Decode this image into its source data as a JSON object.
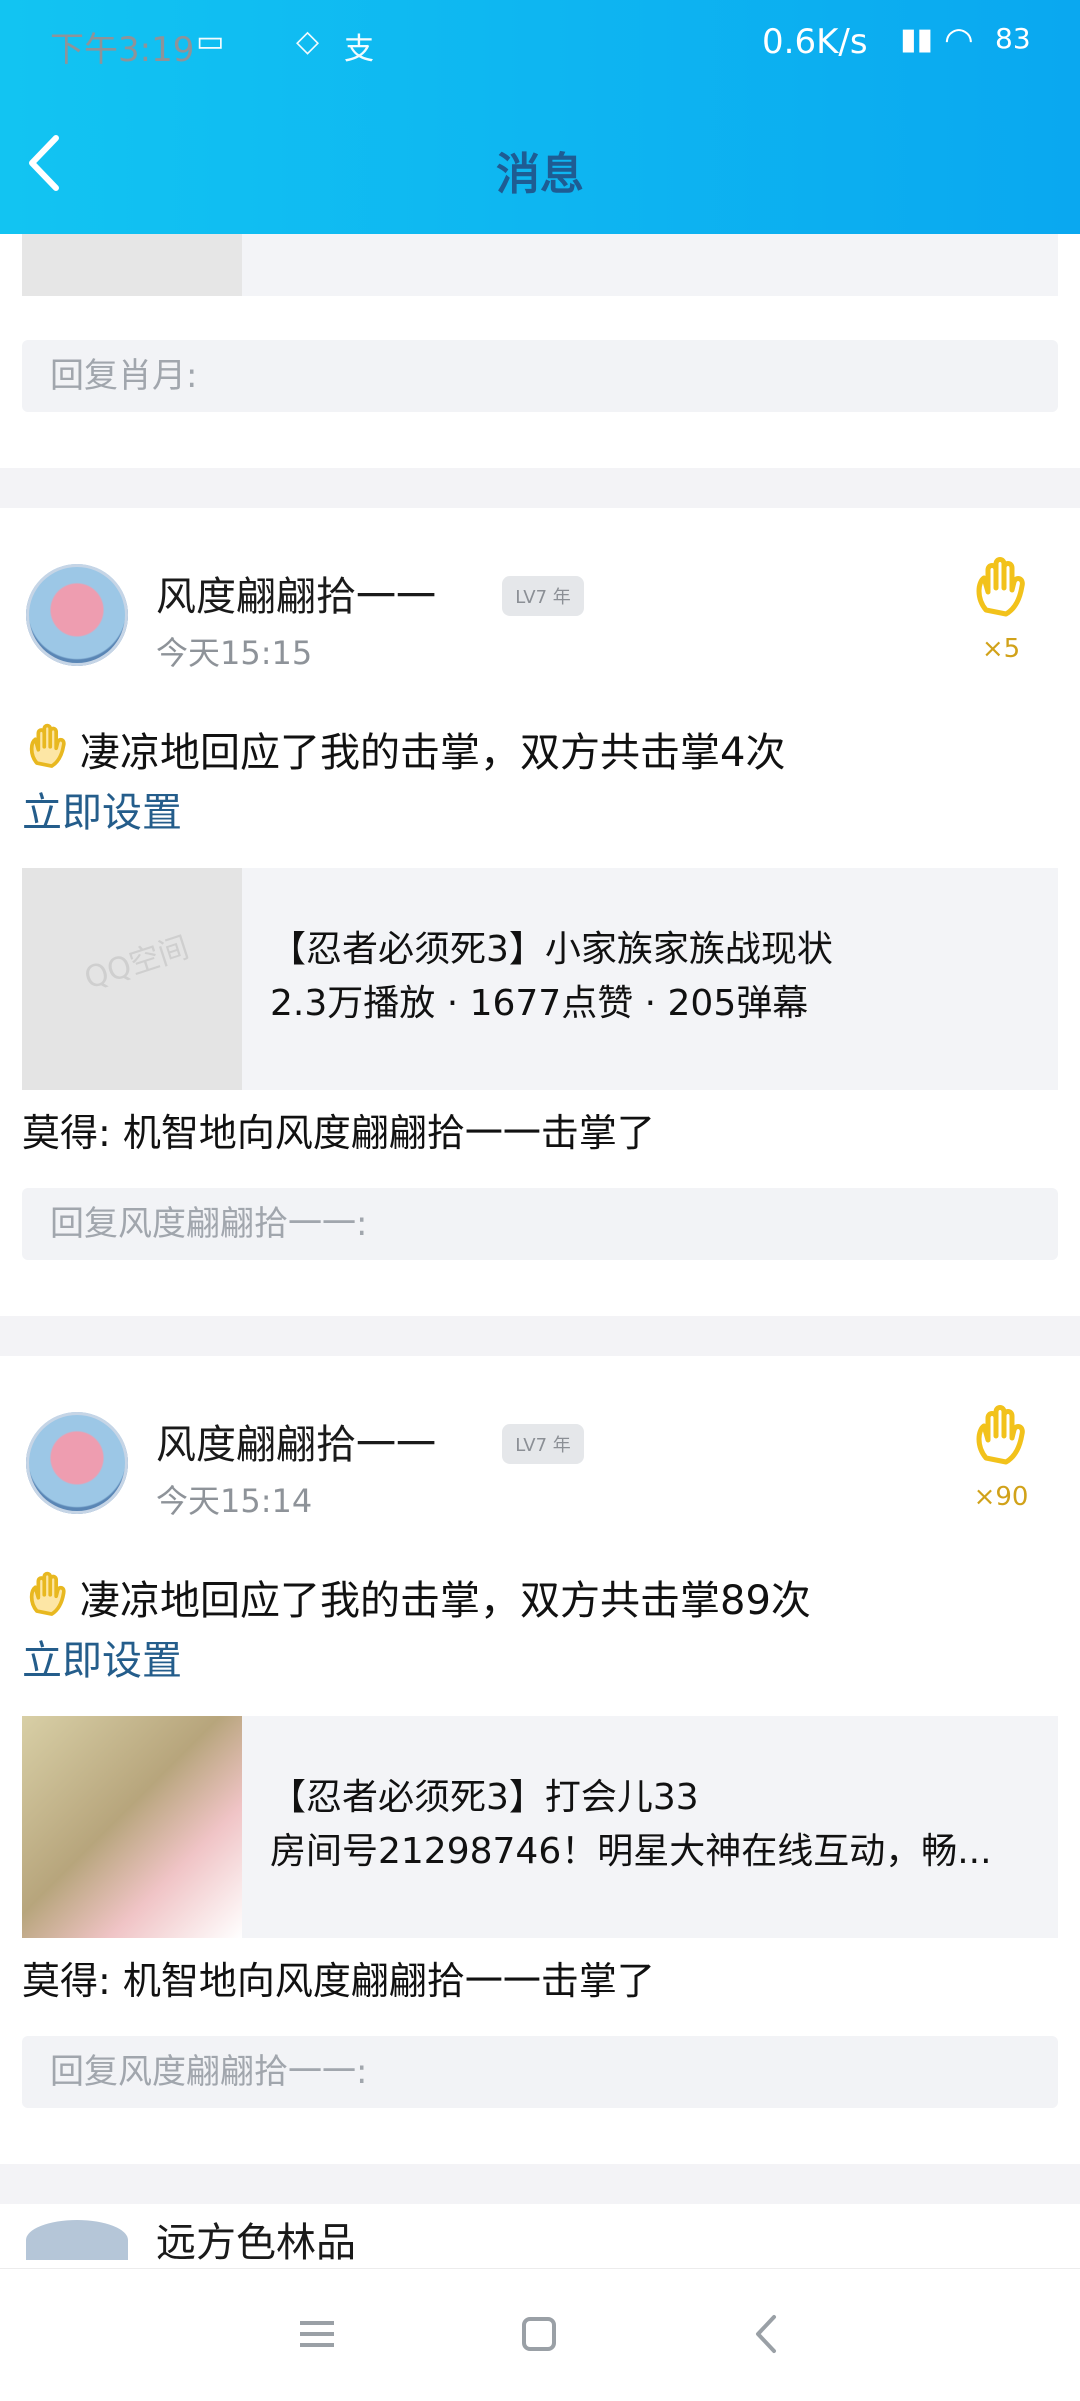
{
  "status_bar": {
    "time": "下午3:19",
    "net_speed": "0.6K/s",
    "battery": "83"
  },
  "header": {
    "title": "消息"
  },
  "top_partial": {
    "reply_placeholder": "回复肖月:"
  },
  "notifications": [
    {
      "user": "风度翩翩拾一一",
      "badge": "LV7 年",
      "time": "今天15:15",
      "clap_count": "×5",
      "action_text": "凄凉地回应了我的击掌，双方共击掌4次",
      "link": "立即设置",
      "card_title": "【忍者必须死3】小家族家族战现状",
      "card_subtitle": "2.3万播放 · 1677点赞 · 205弹幕",
      "thumb_label": "QQ空间",
      "reply_sent": "莫得: 机智地向风度翩翩拾一一击掌了",
      "reply_placeholder": "回复风度翩翩拾一一:"
    },
    {
      "user": "风度翩翩拾一一",
      "badge": "LV7 年",
      "time": "今天15:14",
      "clap_count": "×90",
      "action_text": "凄凉地回应了我的击掌，双方共击掌89次",
      "link": "立即设置",
      "card_title": "【忍者必须死3】打会儿33",
      "card_subtitle": "房间号21298746！明星大神在线互动，畅...",
      "reply_sent": "莫得: 机智地向风度翩翩拾一一击掌了",
      "reply_placeholder": "回复风度翩翩拾一一:"
    }
  ],
  "partial_next": {
    "user": "远方色林品"
  },
  "colors": {
    "header": "#0aa8f0",
    "link": "#245d8b",
    "clap": "#f2c21b"
  }
}
